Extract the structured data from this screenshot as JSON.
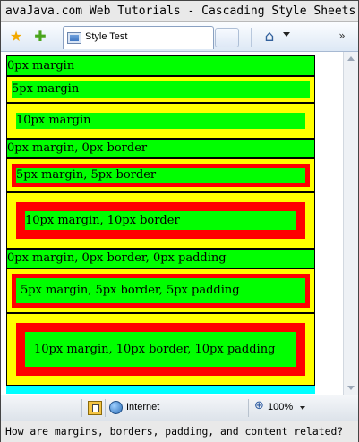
{
  "window": {
    "title": "avaJava.com Web Tutorials - Cascading Style Sheets"
  },
  "toolbar": {
    "favorites_icon": "star-icon",
    "add_favorite_icon": "add-favorite-icon",
    "tab_title": "Style Test",
    "home_icon": "home-icon",
    "more_icon": "chevron-right-icon"
  },
  "page": {
    "groups": [
      {
        "header": "0px margin",
        "boxes": [
          {
            "label": "5px margin"
          },
          {
            "label": "10px margin"
          }
        ]
      },
      {
        "header": "0px margin, 0px border",
        "boxes": [
          {
            "label": "5px margin, 5px border"
          },
          {
            "label": "10px margin, 10px border"
          }
        ]
      },
      {
        "header": "0px margin, 0px border, 0px padding",
        "boxes": [
          {
            "label": "5px margin, 5px border, 5px padding"
          },
          {
            "label": "10px margin, 10px border, 10px padding"
          }
        ]
      }
    ],
    "colors": {
      "background": "#00ffff",
      "outer_box": "#ffff00",
      "inner_box": "#00ff00",
      "border": "#ff0000"
    }
  },
  "statusbar": {
    "zone": "Internet",
    "zoom": "100%"
  },
  "caption": "How are margins, borders, padding, and content related?"
}
